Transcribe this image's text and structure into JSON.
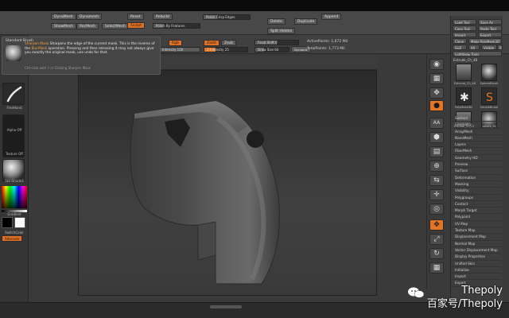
{
  "top_menu": {
    "left_buttons": [
      "DynaMesh",
      "Dynamesh",
      "ShowMesh",
      "RecMesh",
      "SelectMesh"
    ],
    "middle_labels": [
      "Reset",
      "Sculpt",
      "Rebuild",
      "Polish Crisp Edges",
      "Polish By Features",
      "Delete",
      "Duplicate",
      "Split Hidden",
      "Append"
    ],
    "mode_active": "Sculpt",
    "rgb_label": "Rgb",
    "zadd_label": "Zadd",
    "zsub_label": "Zsub",
    "focal_label": "Focal Shift 0",
    "draw_size_label": "Draw Size 64",
    "intensity_label": "Intensity 100",
    "z_intensity_label": "Z Intensity 25",
    "active_points": "ActivePoints: 1,672 Mil",
    "total_points": "TotalPoints: 1,773 Mil",
    "dynamic_label": "Dynamic"
  },
  "left_shelf": {
    "header": "Standard Brush",
    "brush_caption": "Standard",
    "stroke_caption": "FreeHand",
    "alpha_caption": "Alpha Off",
    "texture_caption": "Texture Off",
    "material_caption": "SkinShade4",
    "gradient_label": "Gradient",
    "switch_color_label": "SwitchColor",
    "alternate_label": "Alternate"
  },
  "tooltip": {
    "title": "Sharpen Mask",
    "body_prefix": "Sharpens the edge of the current mask. This is the inverse of the",
    "blur_mask_word": "BlurMask",
    "body_suffix": "operation. Pressing and then releasing it may not always give you exactly the original mask, use undo for that.",
    "footer": "Ctrl-click with Y or Clicking Sharpen Mask"
  },
  "right_strip": {
    "buttons": [
      "BPR",
      "SPix",
      "Scroll",
      "Zoom",
      "Actual",
      "AAHalf",
      "Persp",
      "Floor",
      "Local",
      "LSym",
      "Xyz",
      "Frame",
      "Move",
      "Scale",
      "Rotate",
      "PolyF",
      "Transp",
      "Ghost",
      "Solo",
      "Xpose"
    ]
  },
  "palette": {
    "top_buttons": [
      "Load Tool",
      "Save As",
      "Copy Tool",
      "Paste Tool",
      "Import",
      "Export",
      "Clone",
      "Make PolyMesh3D",
      "GoZ",
      "All",
      "Visible",
      "R"
    ],
    "lightbox_label": "Lightbox▸ Tools",
    "tool_name": "Extrude_Ch_48",
    "thumb_labels": [
      "Extrude_Ch_48",
      "SphereBrush",
      "PolyMesh3D",
      "SimpleBrush",
      "Extrude_Ch_47",
      "sphere_80"
    ],
    "menu_items": [
      "Subtool",
      "Geometry",
      "ArrayMesh",
      "NanoMesh",
      "Layers",
      "FiberMesh",
      "Geometry HD",
      "Preview",
      "Surface",
      "Deformation",
      "Masking",
      "Visibility",
      "Polygroups",
      "Contact",
      "Morph Target",
      "Polypaint",
      "UV Map",
      "Texture Map",
      "Displacement Map",
      "Normal Map",
      "Vector Displacement Map",
      "Display Properties",
      "Unified Skin",
      "Initialize",
      "Import",
      "Export"
    ]
  },
  "watermark": {
    "line1": "Thepoly",
    "line2": "百家号/Thepoly"
  },
  "colors": {
    "accent": "#e27624",
    "ui_dark": "#3a3a3a",
    "viewport_bg": "#2e2e2e"
  }
}
